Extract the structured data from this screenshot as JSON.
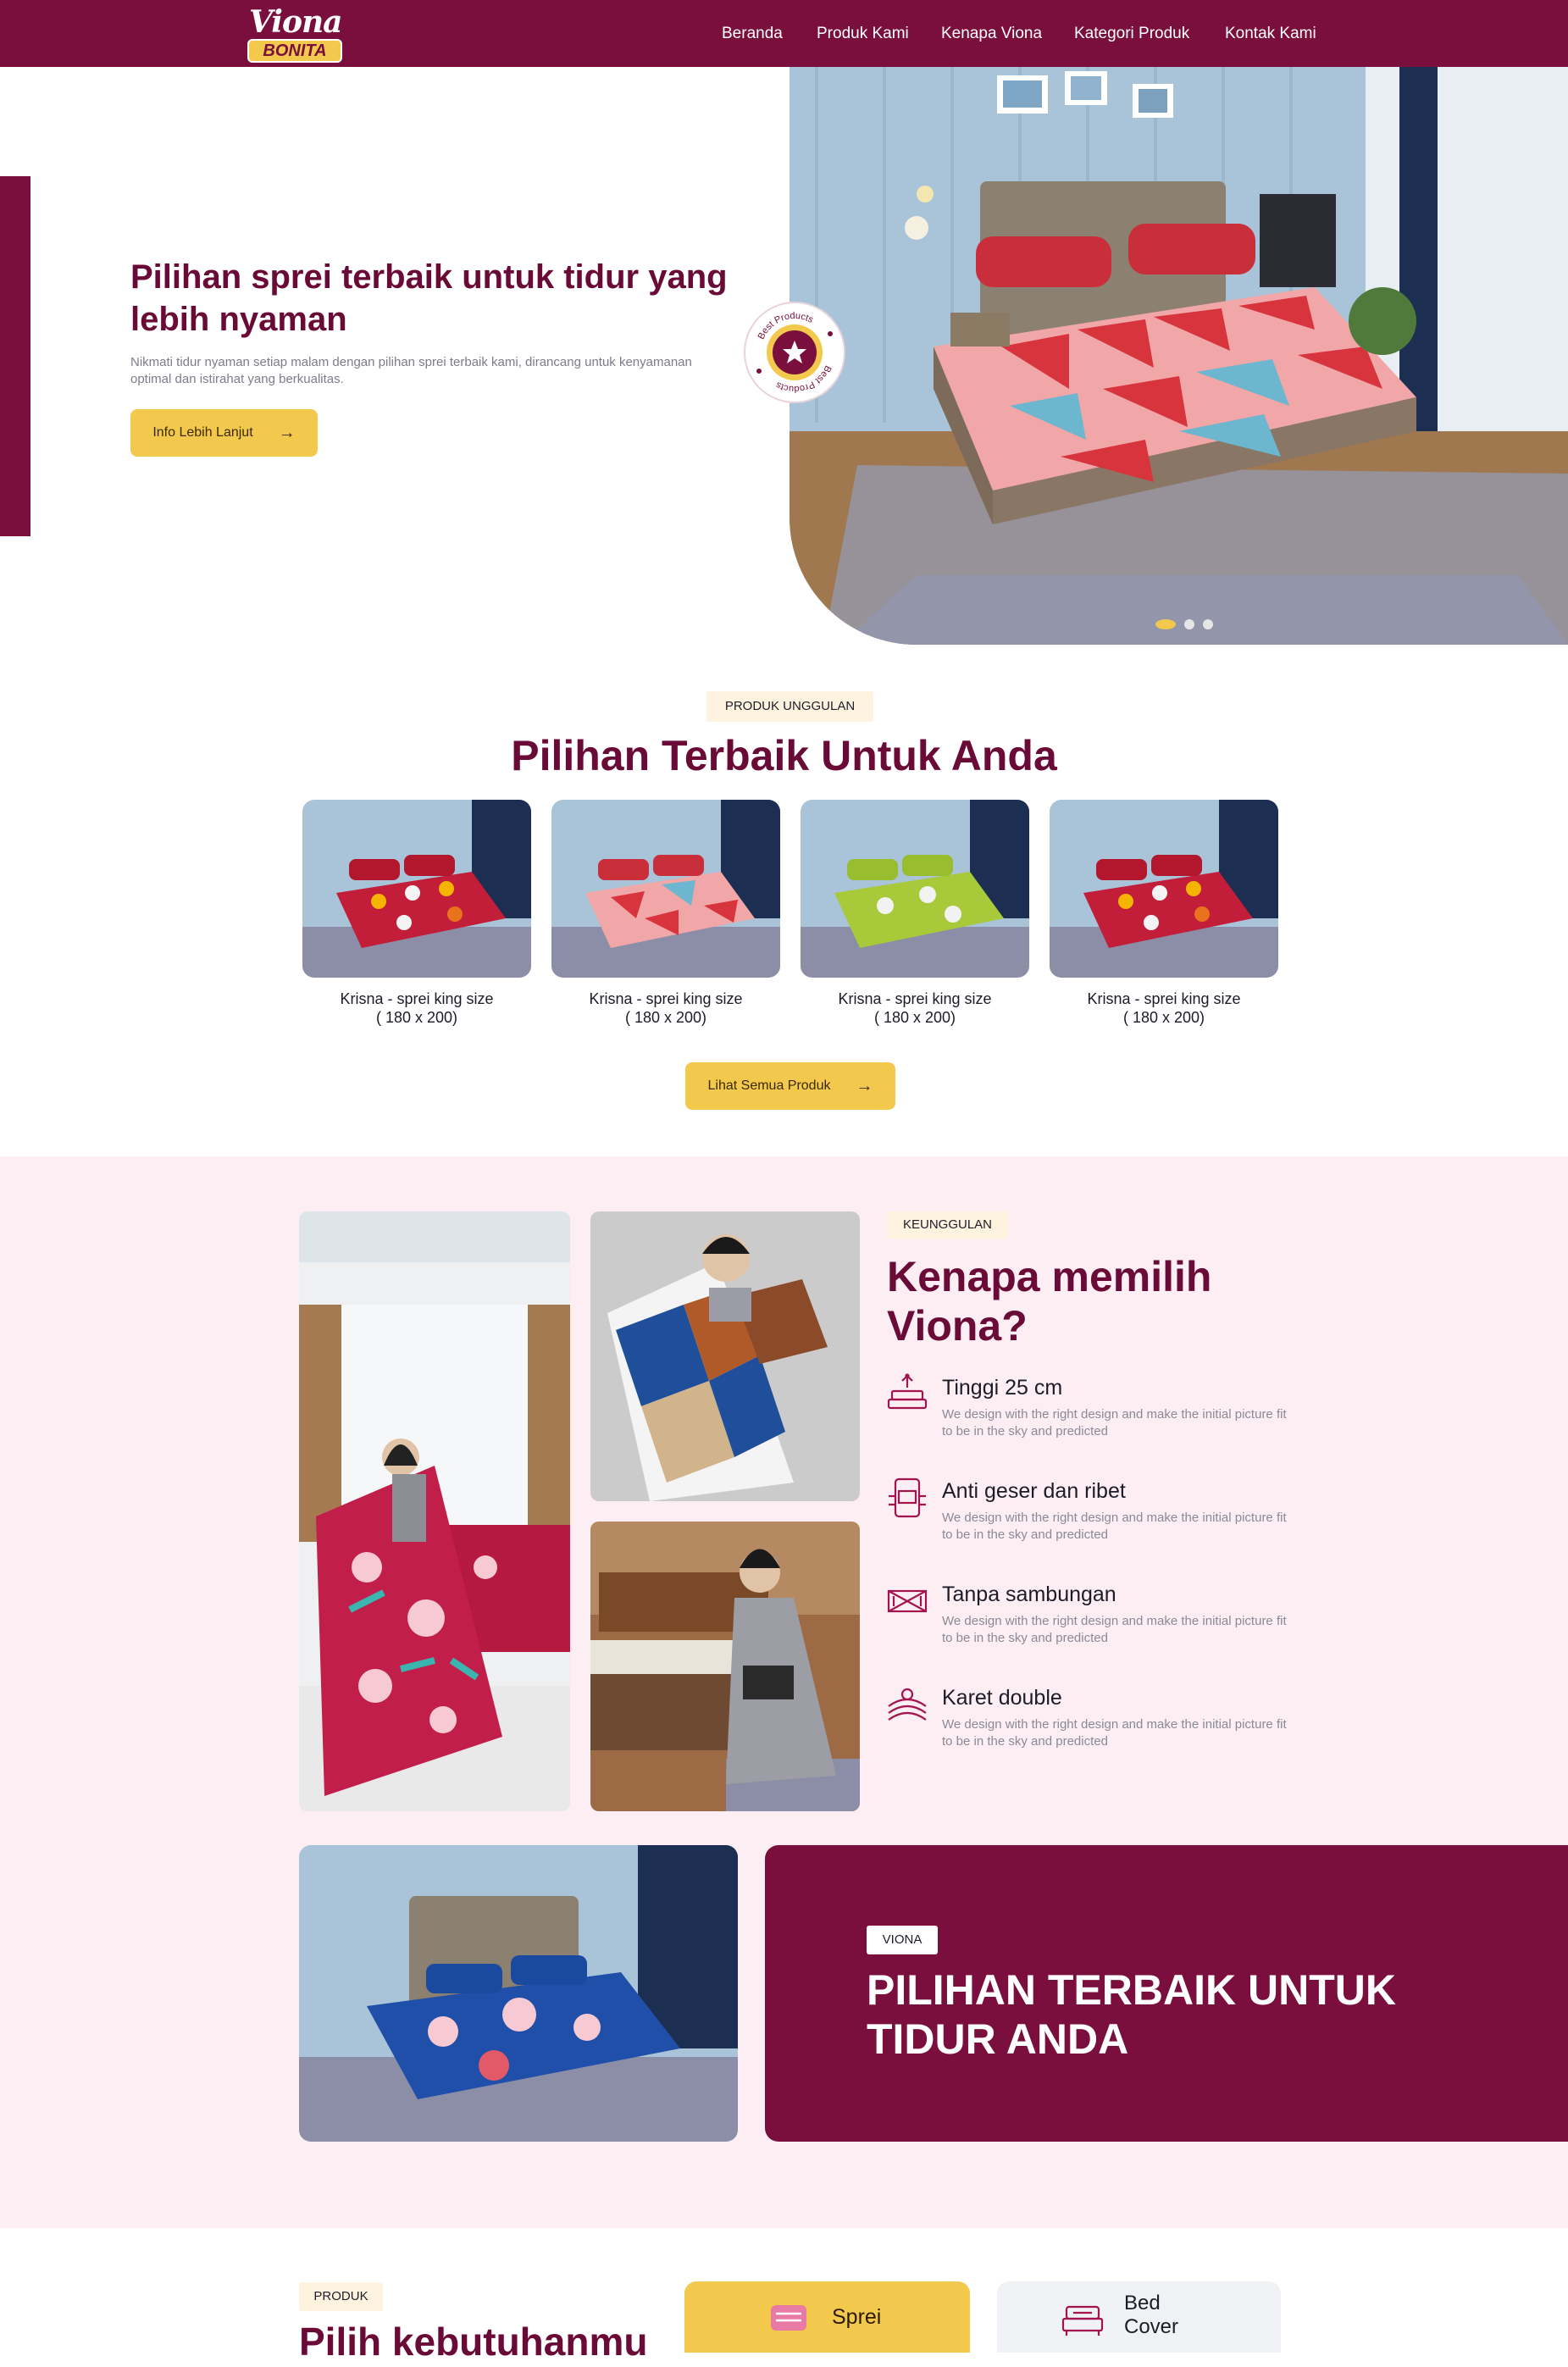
{
  "brand": {
    "line1": "Viona",
    "line2": "BONITA"
  },
  "nav": {
    "items": [
      "Beranda",
      "Produk Kami",
      "Kenapa Viona",
      "Kategori Produk",
      "Kontak Kami"
    ]
  },
  "hero": {
    "title": "Pilihan sprei terbaik untuk tidur yang lebih nyaman",
    "subtitle": "Nikmati tidur nyaman setiap malam dengan pilihan sprei terbaik kami, dirancang untuk kenyamanan optimal dan istirahat yang berkualitas.",
    "button": "Info Lebih Lanjut",
    "badge_text": "Best Products Best Products",
    "slides": 3,
    "active_slide": 1
  },
  "featured": {
    "tag": "PRODUK UNGGULAN",
    "title": "Pilihan Terbaik Untuk Anda",
    "products": [
      {
        "name": "Krisna - sprei king size",
        "size": "( 180 x 200)",
        "pattern": "red-floral"
      },
      {
        "name": "Krisna - sprei king size",
        "size": "( 180 x 200)",
        "pattern": "red-diamond"
      },
      {
        "name": "Krisna - sprei king size",
        "size": "( 180 x 200)",
        "pattern": "green-floral"
      },
      {
        "name": "Krisna - sprei king size",
        "size": "( 180 x 200)",
        "pattern": "red-floral"
      }
    ],
    "button": "Lihat Semua Produk"
  },
  "why": {
    "tag": "KEUNGGULAN",
    "title": "Kenapa memilih Viona?",
    "features": [
      {
        "icon": "layered-mattress-icon",
        "title": "Tinggi 25 cm",
        "desc": "We design with the right design and make the initial picture fit to be in the sky and predicted"
      },
      {
        "icon": "phone-bed-icon",
        "title": "Anti geser dan ribet",
        "desc": "We design with the right design and make the initial picture fit to be in the sky and predicted"
      },
      {
        "icon": "seamless-fabric-icon",
        "title": "Tanpa sambungan",
        "desc": "We design with the right design and make the initial picture fit to be in the sky and predicted"
      },
      {
        "icon": "elastic-band-icon",
        "title": "Karet double",
        "desc": "We design with the right design and make the initial picture fit to be in the sky and predicted"
      }
    ]
  },
  "banner": {
    "tag": "VIONA",
    "title": "PILIHAN TERBAIK UNTUK TIDUR ANDA"
  },
  "categories": {
    "tag": "PRODUK",
    "title": "Pilih kebutuhanmu",
    "items": [
      {
        "label": "Sprei",
        "icon": "sheet-icon",
        "active": true
      },
      {
        "label": "Bed Cover",
        "icon": "bed-icon",
        "active": false
      }
    ]
  },
  "colors": {
    "primary": "#7a0f3d",
    "accent": "#f2c94c",
    "pink_bg": "#fdeef4",
    "tag_bg": "#fdf3df"
  }
}
